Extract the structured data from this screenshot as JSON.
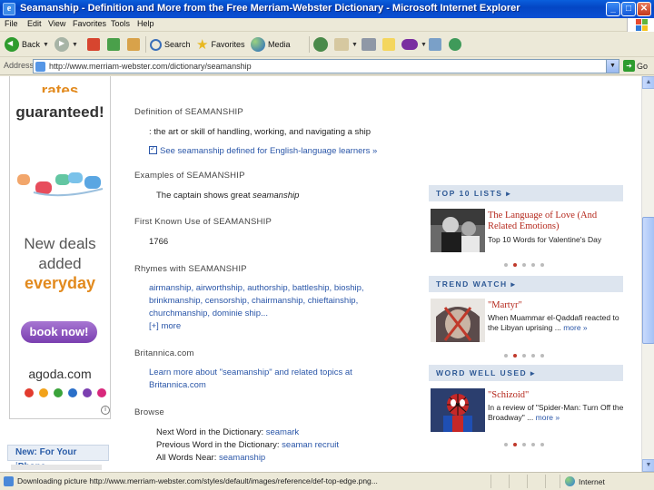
{
  "window": {
    "title": "Seamanship - Definition and More from the Free Merriam-Webster Dictionary - Microsoft Internet Explorer",
    "controls": {
      "minimize": "_",
      "maximize": "□",
      "close": "✕"
    }
  },
  "menu": [
    "File",
    "Edit",
    "View",
    "Favorites",
    "Tools",
    "Help"
  ],
  "toolbar": {
    "back": "Back",
    "search": "Search",
    "favorites": "Favorites",
    "media": "Media"
  },
  "address": {
    "label": "Address",
    "url": "http://www.merriam-webster.com/dictionary/seamanship",
    "go": "Go"
  },
  "ad": {
    "rates": "rates",
    "guaranteed": "guaranteed!",
    "deals_line1": "New deals",
    "deals_line2": "added",
    "everyday": "everyday",
    "button": "book now!",
    "brand": "agoda.com",
    "dot_colors": [
      "#e23b2e",
      "#f2a21a",
      "#3aa33a",
      "#2a6fc9",
      "#7b3fb0",
      "#d8287c"
    ],
    "info": "i"
  },
  "iphone_promo": "New: For Your iPhone",
  "definition": {
    "heading": "Definition of SEAMANSHIP",
    "text": ": the art or skill of handling, working, and navigating a ship",
    "link": "See seamanship",
    "link_suffix": " defined for English-language learners »"
  },
  "examples": {
    "heading": "Examples of SEAMANSHIP",
    "text_prefix": "The captain shows great ",
    "text_em": "seamanship"
  },
  "first_use": {
    "heading": "First Known Use of SEAMANSHIP",
    "year": "1766"
  },
  "rhymes": {
    "heading": "Rhymes with SEAMANSHIP",
    "line1": "airmanship, airworthship, authorship, battleship, bioship,",
    "line2": "brinkmanship, censorship, chairmanship, chieftainship,",
    "line3": "churchmanship, dominie ship...",
    "more": "[+] more"
  },
  "britannica": {
    "heading": "Britannica.com",
    "line1": "Learn more about \"seamanship\" and related topics at",
    "line2": "Britannica.com"
  },
  "browse": {
    "heading": "Browse",
    "next_label": "Next Word in the Dictionary: ",
    "next_link": "seamark",
    "prev_label": "Previous Word in the Dictionary: ",
    "prev_link": "seaman recruit",
    "all_label": "All Words Near: ",
    "all_link": "seamanship"
  },
  "right": {
    "top10": {
      "header": "TOP 10 LISTS ▸",
      "title_line1": "The Language of Love (And",
      "title_line2": "Related Emotions)",
      "desc": "Top 10 Words for Valentine's Day"
    },
    "trend": {
      "header": "TREND WATCH ▸",
      "title": "\"Martyr\"",
      "desc_line1": "When Muammar el-Qaddafi reacted to",
      "desc_line2": "the Libyan uprising ...",
      "more": "more »"
    },
    "word": {
      "header": "WORD WELL USED ▸",
      "title": "\"Schizoid\"",
      "desc_line1": "In a review of \"Spider-Man: Turn Off the",
      "desc_line2": "Broadway\" ...",
      "more": "more »"
    }
  },
  "status": {
    "text": "Downloading picture http://www.merriam-webster.com/styles/default/images/reference/def-top-edge.png...",
    "zone": "Internet"
  },
  "colors": {
    "link": "#2a56a8",
    "title_red": "#b4261a",
    "brand_orange": "#e28a1e",
    "xp_blue": "#0a4fd4"
  }
}
